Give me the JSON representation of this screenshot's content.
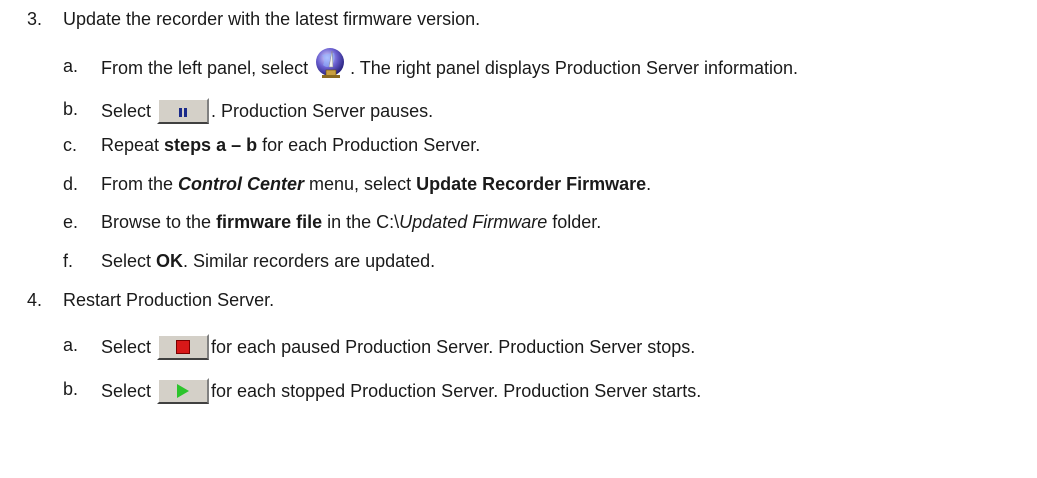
{
  "steps": [
    {
      "number": "3.",
      "text": "Update the recorder with the latest firmware version.",
      "substeps": [
        {
          "letter": "a.",
          "t1": "From the left panel, select ",
          "icon": "production-server-globe-icon",
          "t2": ". The right panel displays Production Server information."
        },
        {
          "letter": "b.",
          "t1": "Select ",
          "icon": "pause-icon",
          "t2": ". Production Server pauses."
        },
        {
          "letter": "c.",
          "t1": "Repeat ",
          "b1": "steps a – b",
          "t2": " for each Production Server."
        },
        {
          "letter": "d.",
          "t1": "From the ",
          "bi1": "Control Center",
          "t2": " menu, select ",
          "b1": "Update Recorder Firmware",
          "t3": "."
        },
        {
          "letter": "e.",
          "t1": "Browse to the ",
          "b1": "firmware file",
          "t2": " in the C:\\",
          "i1": "Updated Firmware",
          "t3": " folder."
        },
        {
          "letter": "f.",
          "t1": "Select ",
          "b1": "OK",
          "t2": ". Similar recorders are updated."
        }
      ]
    },
    {
      "number": "4.",
      "text": "Restart Production Server.",
      "substeps": [
        {
          "letter": "a.",
          "t1": "Select ",
          "icon": "stop-icon",
          "t2": " for each paused Production Server. Production Server stops."
        },
        {
          "letter": "b.",
          "t1": "Select ",
          "icon": "play-icon",
          "t2": " for each stopped Production Server. Production Server starts."
        }
      ]
    }
  ]
}
